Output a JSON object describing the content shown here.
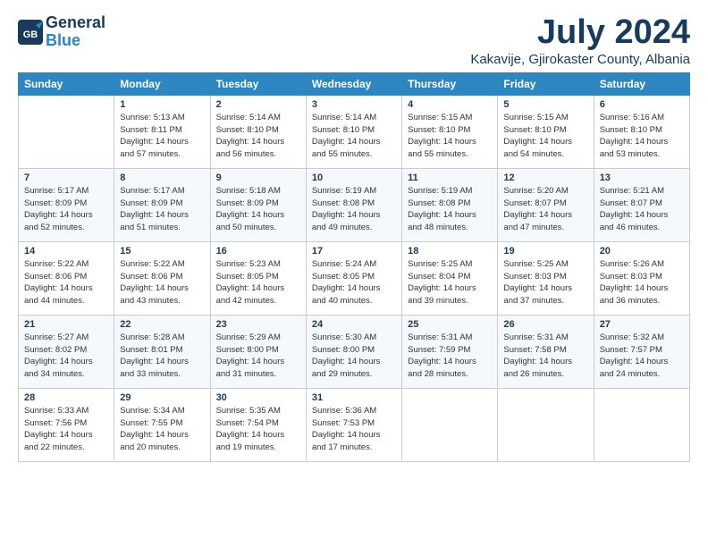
{
  "app": {
    "logo_line1": "General",
    "logo_line2": "Blue"
  },
  "header": {
    "month": "July 2024",
    "location": "Kakavije, Gjirokaster County, Albania"
  },
  "weekdays": [
    "Sunday",
    "Monday",
    "Tuesday",
    "Wednesday",
    "Thursday",
    "Friday",
    "Saturday"
  ],
  "weeks": [
    [
      {
        "day": "",
        "info": ""
      },
      {
        "day": "1",
        "info": "Sunrise: 5:13 AM\nSunset: 8:11 PM\nDaylight: 14 hours\nand 57 minutes."
      },
      {
        "day": "2",
        "info": "Sunrise: 5:14 AM\nSunset: 8:10 PM\nDaylight: 14 hours\nand 56 minutes."
      },
      {
        "day": "3",
        "info": "Sunrise: 5:14 AM\nSunset: 8:10 PM\nDaylight: 14 hours\nand 55 minutes."
      },
      {
        "day": "4",
        "info": "Sunrise: 5:15 AM\nSunset: 8:10 PM\nDaylight: 14 hours\nand 55 minutes."
      },
      {
        "day": "5",
        "info": "Sunrise: 5:15 AM\nSunset: 8:10 PM\nDaylight: 14 hours\nand 54 minutes."
      },
      {
        "day": "6",
        "info": "Sunrise: 5:16 AM\nSunset: 8:10 PM\nDaylight: 14 hours\nand 53 minutes."
      }
    ],
    [
      {
        "day": "7",
        "info": "Sunrise: 5:17 AM\nSunset: 8:09 PM\nDaylight: 14 hours\nand 52 minutes."
      },
      {
        "day": "8",
        "info": "Sunrise: 5:17 AM\nSunset: 8:09 PM\nDaylight: 14 hours\nand 51 minutes."
      },
      {
        "day": "9",
        "info": "Sunrise: 5:18 AM\nSunset: 8:09 PM\nDaylight: 14 hours\nand 50 minutes."
      },
      {
        "day": "10",
        "info": "Sunrise: 5:19 AM\nSunset: 8:08 PM\nDaylight: 14 hours\nand 49 minutes."
      },
      {
        "day": "11",
        "info": "Sunrise: 5:19 AM\nSunset: 8:08 PM\nDaylight: 14 hours\nand 48 minutes."
      },
      {
        "day": "12",
        "info": "Sunrise: 5:20 AM\nSunset: 8:07 PM\nDaylight: 14 hours\nand 47 minutes."
      },
      {
        "day": "13",
        "info": "Sunrise: 5:21 AM\nSunset: 8:07 PM\nDaylight: 14 hours\nand 46 minutes."
      }
    ],
    [
      {
        "day": "14",
        "info": "Sunrise: 5:22 AM\nSunset: 8:06 PM\nDaylight: 14 hours\nand 44 minutes."
      },
      {
        "day": "15",
        "info": "Sunrise: 5:22 AM\nSunset: 8:06 PM\nDaylight: 14 hours\nand 43 minutes."
      },
      {
        "day": "16",
        "info": "Sunrise: 5:23 AM\nSunset: 8:05 PM\nDaylight: 14 hours\nand 42 minutes."
      },
      {
        "day": "17",
        "info": "Sunrise: 5:24 AM\nSunset: 8:05 PM\nDaylight: 14 hours\nand 40 minutes."
      },
      {
        "day": "18",
        "info": "Sunrise: 5:25 AM\nSunset: 8:04 PM\nDaylight: 14 hours\nand 39 minutes."
      },
      {
        "day": "19",
        "info": "Sunrise: 5:25 AM\nSunset: 8:03 PM\nDaylight: 14 hours\nand 37 minutes."
      },
      {
        "day": "20",
        "info": "Sunrise: 5:26 AM\nSunset: 8:03 PM\nDaylight: 14 hours\nand 36 minutes."
      }
    ],
    [
      {
        "day": "21",
        "info": "Sunrise: 5:27 AM\nSunset: 8:02 PM\nDaylight: 14 hours\nand 34 minutes."
      },
      {
        "day": "22",
        "info": "Sunrise: 5:28 AM\nSunset: 8:01 PM\nDaylight: 14 hours\nand 33 minutes."
      },
      {
        "day": "23",
        "info": "Sunrise: 5:29 AM\nSunset: 8:00 PM\nDaylight: 14 hours\nand 31 minutes."
      },
      {
        "day": "24",
        "info": "Sunrise: 5:30 AM\nSunset: 8:00 PM\nDaylight: 14 hours\nand 29 minutes."
      },
      {
        "day": "25",
        "info": "Sunrise: 5:31 AM\nSunset: 7:59 PM\nDaylight: 14 hours\nand 28 minutes."
      },
      {
        "day": "26",
        "info": "Sunrise: 5:31 AM\nSunset: 7:58 PM\nDaylight: 14 hours\nand 26 minutes."
      },
      {
        "day": "27",
        "info": "Sunrise: 5:32 AM\nSunset: 7:57 PM\nDaylight: 14 hours\nand 24 minutes."
      }
    ],
    [
      {
        "day": "28",
        "info": "Sunrise: 5:33 AM\nSunset: 7:56 PM\nDaylight: 14 hours\nand 22 minutes."
      },
      {
        "day": "29",
        "info": "Sunrise: 5:34 AM\nSunset: 7:55 PM\nDaylight: 14 hours\nand 20 minutes."
      },
      {
        "day": "30",
        "info": "Sunrise: 5:35 AM\nSunset: 7:54 PM\nDaylight: 14 hours\nand 19 minutes."
      },
      {
        "day": "31",
        "info": "Sunrise: 5:36 AM\nSunset: 7:53 PM\nDaylight: 14 hours\nand 17 minutes."
      },
      {
        "day": "",
        "info": ""
      },
      {
        "day": "",
        "info": ""
      },
      {
        "day": "",
        "info": ""
      }
    ]
  ]
}
